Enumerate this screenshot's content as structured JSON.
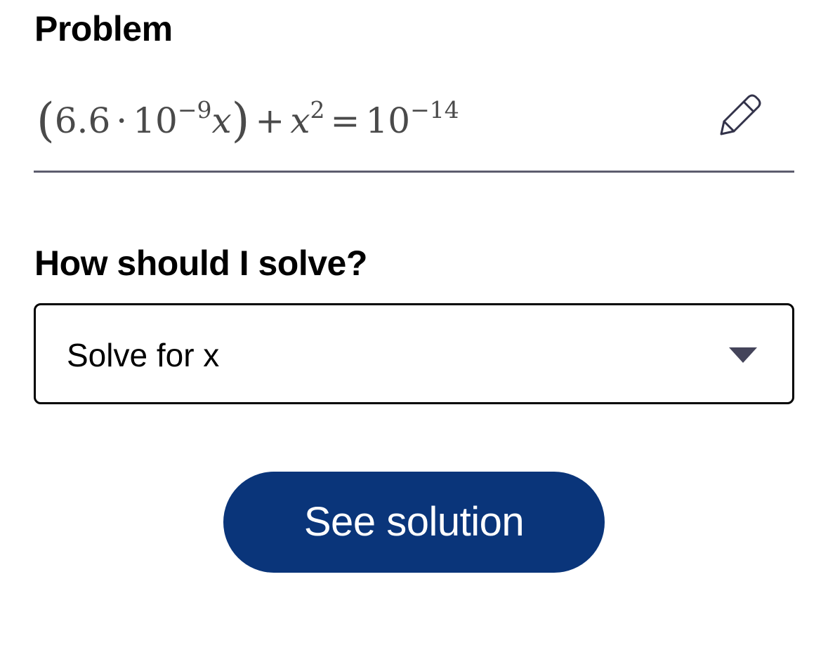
{
  "problem": {
    "title": "Problem",
    "equation": {
      "coefficient": "6.6",
      "dot": "·",
      "base_1": "10",
      "exp_1": "−9",
      "var_1": "x",
      "plus": "+",
      "var_2": "x",
      "exp_2": "2",
      "equals": "=",
      "base_2": "10",
      "exp_3": "−14"
    },
    "edit_icon": "pencil-icon"
  },
  "method": {
    "question": "How should I solve?",
    "selected": "Solve for x",
    "dropdown_icon": "caret-down-icon"
  },
  "actions": {
    "solution_label": "See solution"
  },
  "colors": {
    "primary_button": "#0a357a",
    "field_underline": "#5c5c6e",
    "equation_text": "#4a4a4a",
    "caret": "#44445a"
  }
}
